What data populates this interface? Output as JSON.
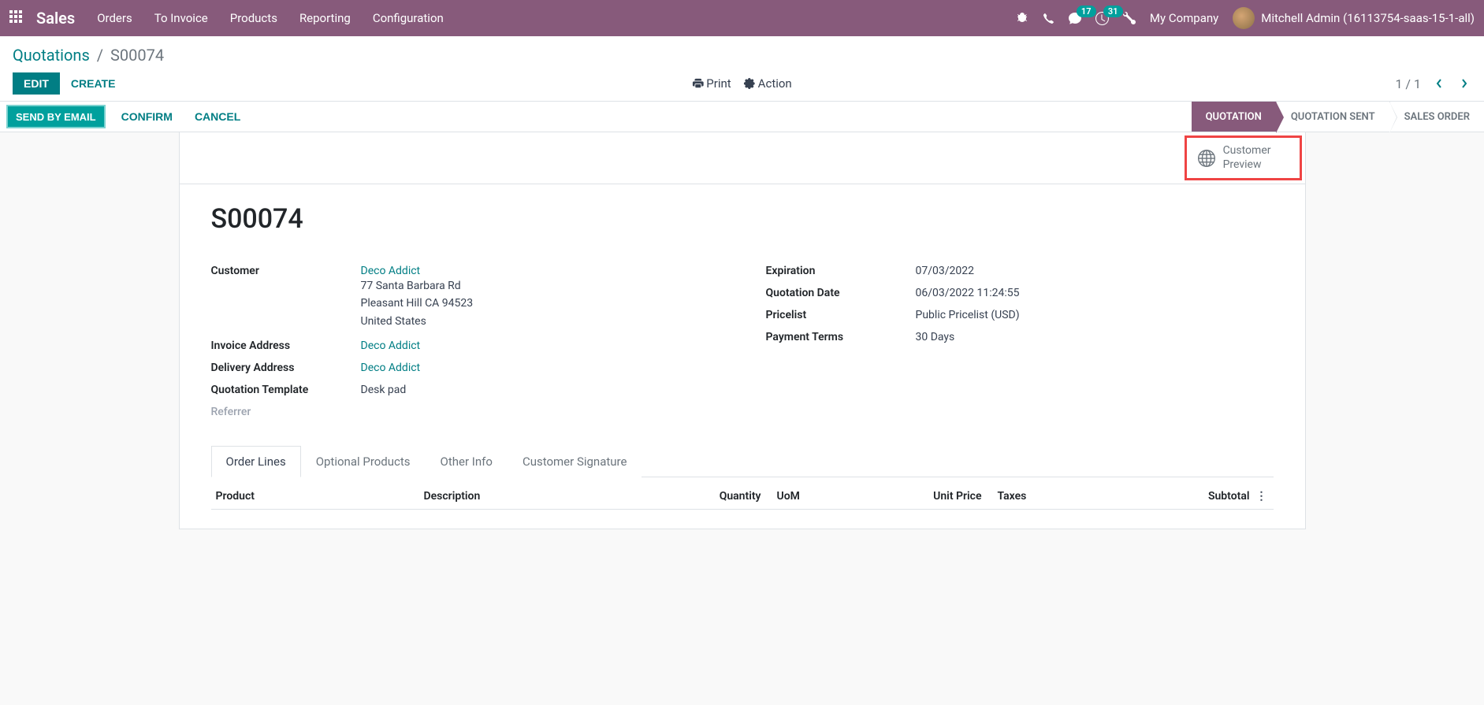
{
  "nav": {
    "brand": "Sales",
    "menu": [
      "Orders",
      "To Invoice",
      "Products",
      "Reporting",
      "Configuration"
    ],
    "badges": {
      "chat": "17",
      "activity": "31"
    },
    "company": "My Company",
    "user": "Mitchell Admin (16113754-saas-15-1-all)"
  },
  "breadcrumb": {
    "root": "Quotations",
    "current": "S00074"
  },
  "buttons": {
    "edit": "EDIT",
    "create": "CREATE",
    "print": "Print",
    "action": "Action",
    "send": "SEND BY EMAIL",
    "confirm": "CONFIRM",
    "cancel": "CANCEL"
  },
  "pager": {
    "text": "1 / 1"
  },
  "stages": [
    "QUOTATION",
    "QUOTATION SENT",
    "SALES ORDER"
  ],
  "stat_button": {
    "line1": "Customer",
    "line2": "Preview"
  },
  "record": {
    "name": "S00074",
    "left": {
      "customer_label": "Customer",
      "customer_name": "Deco Addict",
      "customer_addr1": "77 Santa Barbara Rd",
      "customer_addr2": "Pleasant Hill CA 94523",
      "customer_addr3": "United States",
      "invoice_label": "Invoice Address",
      "invoice_value": "Deco Addict",
      "delivery_label": "Delivery Address",
      "delivery_value": "Deco Addict",
      "template_label": "Quotation Template",
      "template_value": "Desk pad",
      "referrer_label": "Referrer"
    },
    "right": {
      "expiration_label": "Expiration",
      "expiration_value": "07/03/2022",
      "qdate_label": "Quotation Date",
      "qdate_value": "06/03/2022 11:24:55",
      "pricelist_label": "Pricelist",
      "pricelist_value": "Public Pricelist (USD)",
      "terms_label": "Payment Terms",
      "terms_value": "30 Days"
    }
  },
  "tabs": [
    "Order Lines",
    "Optional Products",
    "Other Info",
    "Customer Signature"
  ],
  "table": {
    "headers": {
      "product": "Product",
      "description": "Description",
      "quantity": "Quantity",
      "uom": "UoM",
      "unit_price": "Unit Price",
      "taxes": "Taxes",
      "subtotal": "Subtotal"
    }
  }
}
